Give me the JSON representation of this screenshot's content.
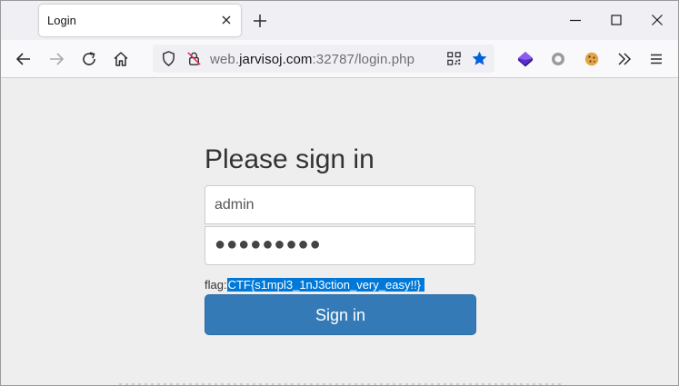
{
  "browser": {
    "tab": {
      "title": "Login"
    },
    "url": {
      "prefix": "web.",
      "host": "jarvisoj.com",
      "suffix": ":32787/login.php"
    },
    "colors": {
      "bookmark_star": "#0060df",
      "ext_purple": "#5b2bd6"
    },
    "icons": {
      "tab_close": "close-icon",
      "new_tab": "plus-icon",
      "minimize": "minimize-icon",
      "maximize": "maximize-icon",
      "close_window": "close-icon",
      "back": "arrow-left-icon",
      "forward": "arrow-right-icon",
      "reload": "reload-icon",
      "home": "home-icon",
      "tracking": "shield-icon",
      "insecure": "lock-strikethrough-icon",
      "qr": "qr-code-icon",
      "bookmark": "star-icon",
      "extension1": "layers-icon",
      "extension2": "circle-icon",
      "extension3": "cookie-icon",
      "overflow": "chevron-double-right-icon",
      "menu": "hamburger-menu-icon"
    }
  },
  "login": {
    "heading": "Please sign in",
    "username": "admin",
    "password_mask": "●●●●●●●●●",
    "flag_label": "flag:",
    "flag_value": "CTF{s1mpl3_1nJ3ction_very_easy!!}",
    "submit_label": "Sign in",
    "submit_color": "#337ab7"
  }
}
